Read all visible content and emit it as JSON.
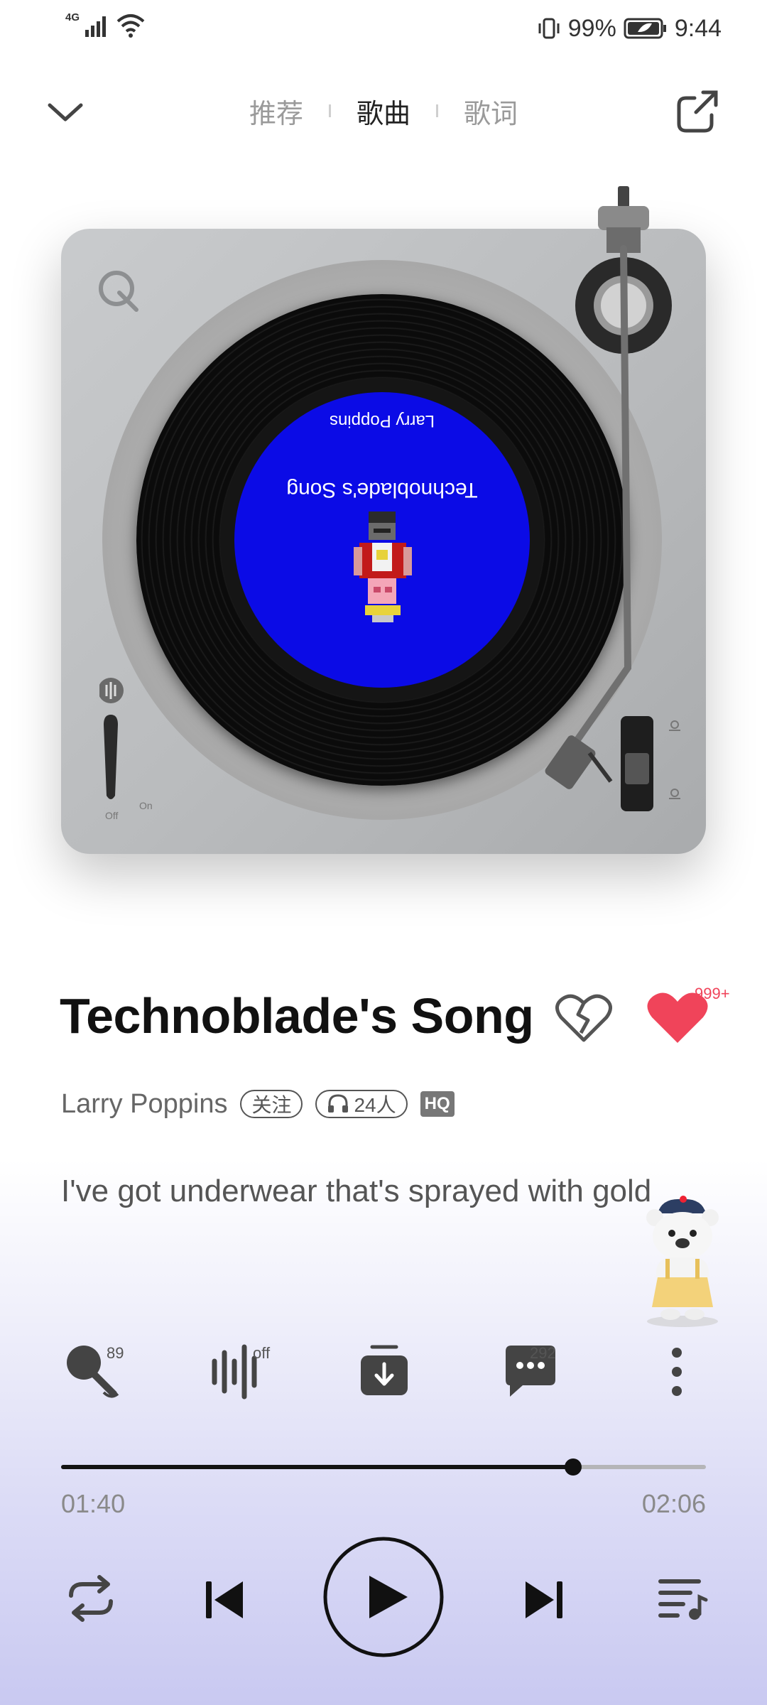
{
  "status_bar": {
    "network": "4G",
    "battery": "99%",
    "time": "9:44"
  },
  "header": {
    "tabs": [
      "推荐",
      "歌曲",
      "歌词"
    ],
    "active_tab": "歌曲"
  },
  "record": {
    "label_color": "#0b0be6",
    "title": "Technoblade's Song",
    "artist": "Larry Poppins",
    "deck_switch_off": "Off",
    "deck_switch_on": "On"
  },
  "song": {
    "title": "Technoblade's Song",
    "artist": "Larry Poppins",
    "follow_label": "关注",
    "listeners": "24人",
    "quality": "HQ",
    "like_count": "999+",
    "lyric": "I've got underwear that's sprayed with gold"
  },
  "actions": {
    "sing_count": "89",
    "effect_state": "off",
    "comment_count": "292"
  },
  "progress": {
    "current": "01:40",
    "total": "02:06",
    "fraction": 0.794
  },
  "colors": {
    "accent_heart": "#f0445a",
    "label_blue": "#0b0be6"
  }
}
